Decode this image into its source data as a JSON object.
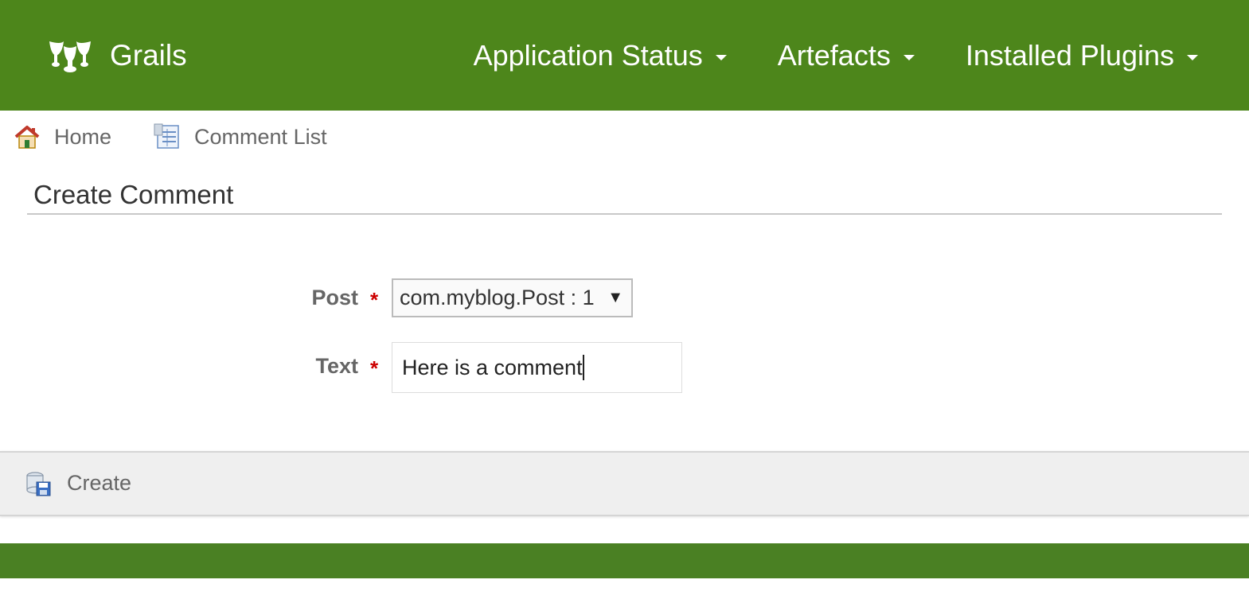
{
  "header": {
    "brand": "Grails",
    "nav": [
      {
        "label": "Application Status"
      },
      {
        "label": "Artefacts"
      },
      {
        "label": "Installed Plugins"
      }
    ]
  },
  "breadcrumbs": [
    {
      "label": "Home",
      "icon": "home-icon"
    },
    {
      "label": "Comment List",
      "icon": "list-icon"
    }
  ],
  "page": {
    "title": "Create Comment"
  },
  "form": {
    "post": {
      "label": "Post",
      "required_mark": "*",
      "selected": "com.myblog.Post : 1",
      "arrow": "▼"
    },
    "text": {
      "label": "Text",
      "required_mark": "*",
      "value": "Here is a comment"
    }
  },
  "actions": {
    "create_label": "Create"
  },
  "colors": {
    "header_bg": "#4d861b",
    "footer_bg": "#4a8023",
    "required": "#cc0000"
  }
}
